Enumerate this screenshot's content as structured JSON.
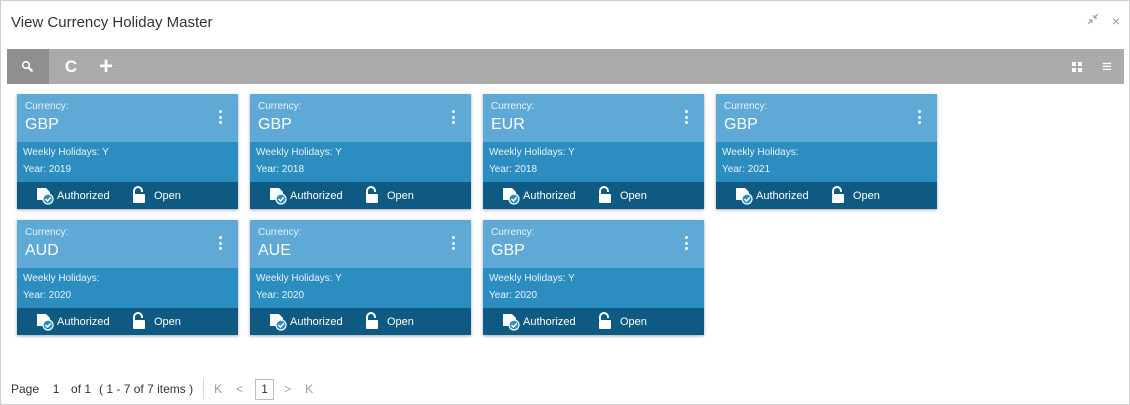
{
  "window": {
    "title": "View Currency Holiday Master",
    "minimize_icon": "collapse-arrows-icon",
    "close_label": "×"
  },
  "toolbar": {
    "search_icon": "search-icon",
    "refresh_label": "C",
    "add_label": "+",
    "grid_view_icon": "grid-view-icon",
    "list_view_label": "≡"
  },
  "cards_common": {
    "currency_label": "Currency:",
    "weekly_prefix": "Weekly Holidays:",
    "year_prefix": "Year:",
    "authorized_label": "Authorized",
    "open_label": "Open"
  },
  "cards": [
    {
      "currency": "GBP",
      "weekly": "Weekly Holidays: Y",
      "year": "Year: 2019"
    },
    {
      "currency": "GBP",
      "weekly": "Weekly Holidays: Y",
      "year": "Year: 2018"
    },
    {
      "currency": "EUR",
      "weekly": "Weekly Holidays: Y",
      "year": "Year: 2018"
    },
    {
      "currency": "GBP",
      "weekly": "Weekly Holidays:",
      "year": "Year: 2021"
    },
    {
      "currency": "AUD",
      "weekly": "Weekly Holidays:",
      "year": "Year: 2020"
    },
    {
      "currency": "AUE",
      "weekly": "Weekly Holidays: Y",
      "year": "Year: 2020"
    },
    {
      "currency": "GBP",
      "weekly": "Weekly Holidays: Y",
      "year": "Year: 2020"
    }
  ],
  "pagination": {
    "page_label": "Page",
    "page_value": "1",
    "of_label": "of 1",
    "items_label": "( 1 - 7 of 7 items )",
    "first_label": "K",
    "prev_label": "<",
    "current_page": "1",
    "next_label": ">",
    "last_label": "K"
  },
  "colors": {
    "card_header": "#5ea9d6",
    "card_middle": "#2b8dc0",
    "card_footer": "#0e5a82",
    "toolbar": "#a9a9a9"
  }
}
